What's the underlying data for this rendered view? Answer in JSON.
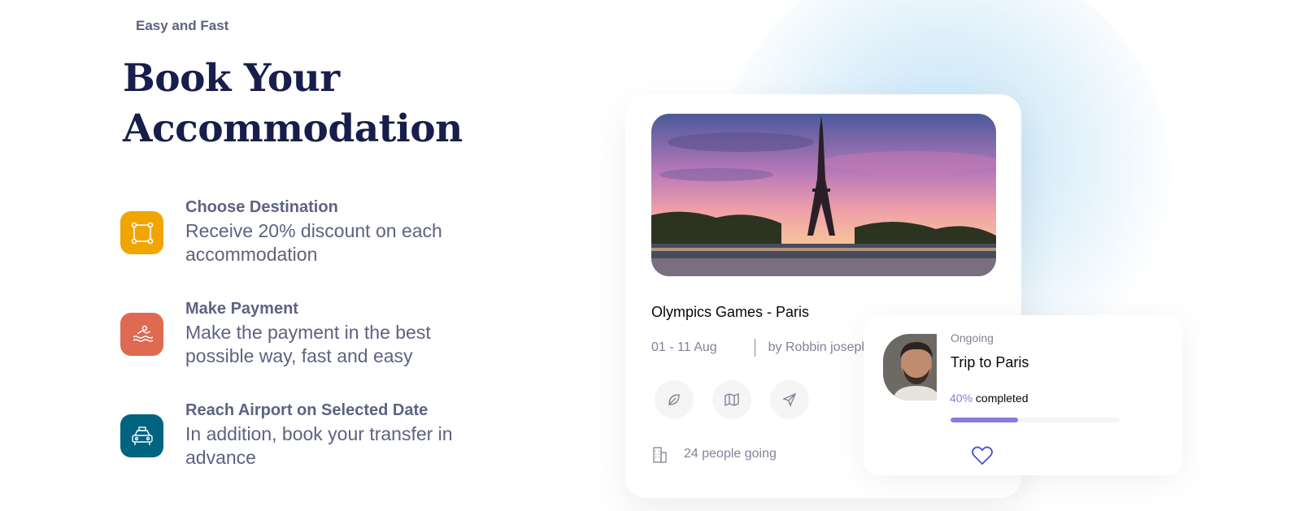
{
  "hero": {
    "eyebrow": "Easy and Fast",
    "headline_line1": "Book Your",
    "headline_line2": "Accommodation"
  },
  "features": [
    {
      "title": "Choose Destination",
      "description": "Receive 20% discount on each accommodation",
      "icon": "selection-square-icon",
      "color": "#f1a501"
    },
    {
      "title": "Make Payment",
      "description": "Make the payment in the best possible way, fast and easy",
      "icon": "water-sport-icon",
      "color": "#df6951"
    },
    {
      "title": "Reach Airport on Selected Date",
      "description": "In addition, book your transfer in advance",
      "icon": "taxi-icon",
      "color": "#006380"
    }
  ],
  "trip_card": {
    "title": "Olympics Games - Paris",
    "dates": "01 - 11 Aug",
    "author": "by Robbin joseph",
    "actions": [
      "leaf-icon",
      "map-icon",
      "send-icon"
    ],
    "going": "24 people going"
  },
  "progress_card": {
    "status": "Ongoing",
    "title": "Trip to Paris",
    "percent_label": "40%",
    "completed_label": "completed",
    "progress": 0.4,
    "accent": "#8a79df"
  }
}
